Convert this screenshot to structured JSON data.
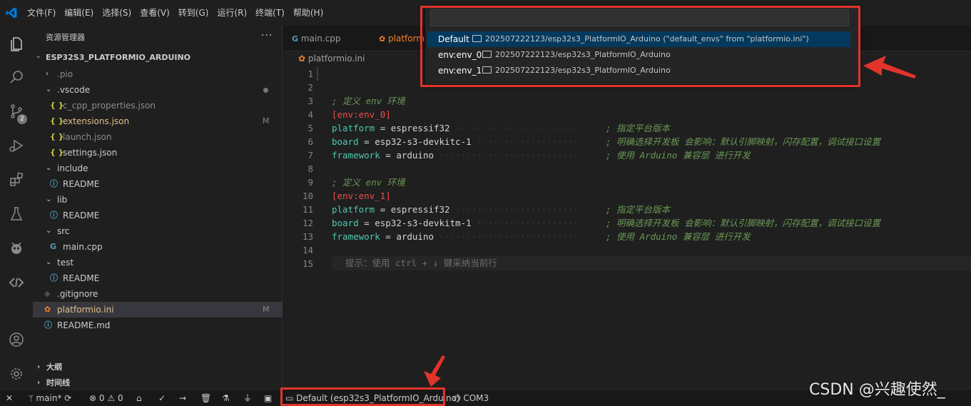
{
  "menubar": {
    "items": [
      "文件(F)",
      "编辑(E)",
      "选择(S)",
      "查看(V)",
      "转到(G)",
      "运行(R)",
      "终端(T)",
      "帮助(H)"
    ]
  },
  "activitybar": {
    "icons": [
      "explorer-icon",
      "search-icon",
      "source-control-icon",
      "run-debug-icon",
      "extensions-icon",
      "testing-icon",
      "platformio-icon",
      "remote-icon",
      "account-icon",
      "settings-gear-icon"
    ],
    "source_control_badge": "2"
  },
  "sidebar": {
    "title": "资源管理器",
    "more": "···",
    "project": "ESP32S3_PLATFORMIO_ARDUINO",
    "tree": [
      {
        "label": ".pio",
        "type": "folder",
        "collapsed": true,
        "depth": 1
      },
      {
        "label": ".vscode",
        "type": "folder",
        "collapsed": false,
        "depth": 1,
        "modified_dot": true
      },
      {
        "label": "c_cpp_properties.json",
        "type": "json",
        "depth": 2
      },
      {
        "label": "extensions.json",
        "type": "json",
        "depth": 2,
        "badge": "M"
      },
      {
        "label": "launch.json",
        "type": "json",
        "depth": 2
      },
      {
        "label": "settings.json",
        "type": "json",
        "depth": 2
      },
      {
        "label": "include",
        "type": "folder",
        "collapsed": false,
        "depth": 1
      },
      {
        "label": "README",
        "type": "info",
        "depth": 2
      },
      {
        "label": "lib",
        "type": "folder",
        "collapsed": false,
        "depth": 1
      },
      {
        "label": "README",
        "type": "info",
        "depth": 2
      },
      {
        "label": "src",
        "type": "folder",
        "collapsed": false,
        "depth": 1
      },
      {
        "label": "main.cpp",
        "type": "cpp",
        "depth": 2
      },
      {
        "label": "test",
        "type": "folder",
        "collapsed": false,
        "depth": 1
      },
      {
        "label": "README",
        "type": "info",
        "depth": 2
      },
      {
        "label": ".gitignore",
        "type": "git",
        "depth": 1
      },
      {
        "label": "platformio.ini",
        "type": "pio",
        "depth": 1,
        "badge": "M",
        "selected": true
      },
      {
        "label": "README.md",
        "type": "info",
        "depth": 1
      }
    ],
    "sections": [
      "大纲",
      "时间线"
    ]
  },
  "editor": {
    "tabs": [
      {
        "label": "main.cpp",
        "type": "cpp",
        "active": false
      },
      {
        "label": "platformio.ini",
        "type": "pio",
        "active": true
      }
    ],
    "breadcrumb": "platformio.ini",
    "lines": [
      {
        "n": "1",
        "text": ""
      },
      {
        "n": "2",
        "text": ""
      },
      {
        "n": "3",
        "kind": "comment",
        "text": "; 定义 env 环境"
      },
      {
        "n": "4",
        "kind": "section",
        "text": "[env:env_0]"
      },
      {
        "n": "5",
        "kind": "kv",
        "key": "platform",
        "value": "espressif32",
        "comment": "; 指定平台版本"
      },
      {
        "n": "6",
        "kind": "kv",
        "key": "board",
        "value": "esp32-s3-devkitc-1",
        "comment": "; 明确选择开发板 会影响：默认引脚映射，闪存配置，调试接口设置"
      },
      {
        "n": "7",
        "kind": "kv",
        "key": "framework",
        "value": "arduino",
        "comment": "; 使用 Arduino 兼容层 进行开发"
      },
      {
        "n": "8",
        "text": ""
      },
      {
        "n": "9",
        "kind": "comment",
        "text": "; 定义 env 环境"
      },
      {
        "n": "10",
        "kind": "section",
        "text": "[env:env_1]"
      },
      {
        "n": "11",
        "kind": "kv",
        "key": "platform",
        "value": "espressif32",
        "comment": "; 指定平台版本"
      },
      {
        "n": "12",
        "kind": "kv",
        "key": "board",
        "value": "esp32-s3-devkitm-1",
        "comment": "; 明确选择开发板 会影响：默认引脚映射，闪存配置，调试接口设置"
      },
      {
        "n": "13",
        "kind": "kv",
        "key": "framework",
        "value": "arduino",
        "comment": "; 使用 Arduino 兼容层 进行开发"
      },
      {
        "n": "14",
        "text": ""
      },
      {
        "n": "15",
        "text": ""
      }
    ],
    "hint": "提示：使用 ctrl + ↓ 键采纳当前行"
  },
  "quickpick": {
    "input_value": "",
    "items": [
      {
        "label": "Default",
        "description": "202507222123/esp32s3_PlatformIO_Arduino (\"default_envs\" from \"platformio.ini\")",
        "active": true
      },
      {
        "label": "env:env_0",
        "description": "202507222123/esp32s3_PlatformIO_Arduino",
        "active": false
      },
      {
        "label": "env:env_1",
        "description": "202507222123/esp32s3_PlatformIO_Arduino",
        "active": false
      }
    ]
  },
  "statusbar": {
    "remote": "✕",
    "branch": "main*",
    "errors": "0",
    "warnings": "0",
    "env": "Default (esp32s3_PlatformIO_Arduino)",
    "port": "COM3"
  },
  "watermark": "CSDN @兴趣使然_",
  "colors": {
    "accent_red": "#e2342b",
    "vscode_blue": "#0078d4",
    "pio_orange": "#f5822a",
    "json_yellow": "#cbcb41",
    "info_blue": "#519aba"
  }
}
